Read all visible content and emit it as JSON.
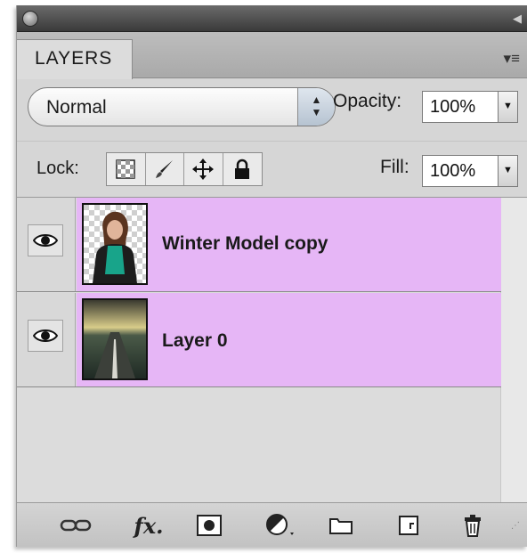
{
  "panel": {
    "tab_label": "LAYERS"
  },
  "blend": {
    "mode": "Normal",
    "opacity_label": "Opacity:",
    "opacity_value": "100%"
  },
  "lock": {
    "label": "Lock:",
    "fill_label": "Fill:",
    "fill_value": "100%"
  },
  "layers": [
    {
      "name": "Winter Model copy",
      "visible": true,
      "selected": true
    },
    {
      "name": "Layer 0",
      "visible": true,
      "selected": true
    }
  ],
  "colors": {
    "selection": "#e6b6f6",
    "panel": "#d6d6d6",
    "titlebar": "#4a4a4a"
  },
  "icons": {
    "titlebar": [
      "close-dot",
      "collapse-arrow"
    ],
    "lock": [
      "lock-transparent-icon",
      "lock-paint-icon",
      "lock-position-icon",
      "lock-all-icon"
    ],
    "footer": [
      "link-icon",
      "fx-icon",
      "mask-icon",
      "adjustment-icon",
      "folder-icon",
      "new-layer-icon",
      "trash-icon"
    ]
  }
}
